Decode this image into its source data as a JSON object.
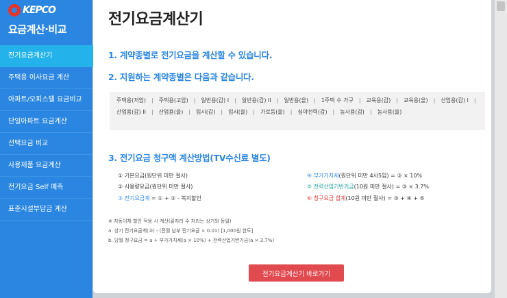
{
  "brand": {
    "logo_text": "KEPCO",
    "side_title": "요금계산·비교"
  },
  "sidebar": {
    "items": [
      {
        "label": "전기요금계산기"
      },
      {
        "label": "주택용 이사요금 계산"
      },
      {
        "label": "아파트/오피스텔 요금비교"
      },
      {
        "label": "단일아파트 요금계산"
      },
      {
        "label": "선택요금 비교"
      },
      {
        "label": "사용제품 요금계산"
      },
      {
        "label": "전기요금 Self 예측"
      },
      {
        "label": "표준시설부담금 계산"
      }
    ]
  },
  "main": {
    "title": "전기요금계산기",
    "section1": "1. 계약종별로 전기요금을 계산할 수 있습니다.",
    "section2": "2. 지원하는 계약종별은 다음과 같습니다.",
    "contract_types": [
      "주택용(저압)",
      "주택용(고압)",
      "일반용(갑) I",
      "일반용(갑) II",
      "일반용(을)",
      "1주택 수 가구",
      "교육용(갑)",
      "교육용(을)",
      "산업용(갑) I",
      "산업용(갑) II",
      "산업용(을)",
      "임시(갑)",
      "임시(을)",
      "가로등(을)",
      "심야전력(갑)",
      "농사용(갑)",
      "농사용(을)"
    ],
    "section3": "3. 전기요금 청구액 계산방법(TV수신료 별도)",
    "calc_left": {
      "l1": "① 기본요금(원단위 미만 절사)",
      "l2": "② 사용량요금(원단위 미만 절사)",
      "l3_a": "③ 전기요금계",
      "l3_b": " = ① + ② - 복지할인"
    },
    "calc_right": {
      "r1_a": "④ 부가가치세",
      "r1_b": "(원단위 미만 4사5입) = ③ × 10%",
      "r2_a": "⑤ 전력산업기반기금",
      "r2_b": "(10원 미만 절사) = ③ × 3.7%",
      "r3_a": "⑥ 청구요금 합계",
      "r3_b": "(10원 미만 절사) = ③ + ④ + ⑤"
    },
    "notes": {
      "n1": "※ 자동이체 할인 적용 시 계산(끝자리 수 처리는 상기와 동일)",
      "n2": "a. 상기 전기요금계(③) - (전월 납부 전기요금 × 0.01) [1,000원 한도]",
      "n3": "b. 당월 청구요금 = a + 부가가치세(a × 10%) + 전력산업기반기금(a × 3.7%)"
    },
    "cta_label": "전기요금계산기 바로가기"
  }
}
